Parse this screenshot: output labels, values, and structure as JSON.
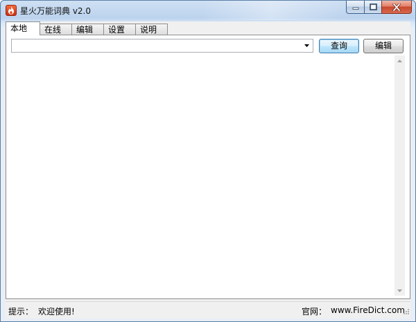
{
  "window": {
    "title": "星火万能词典 v2.0"
  },
  "tabs": [
    {
      "label": "本地",
      "active": true
    },
    {
      "label": "在线",
      "active": false
    },
    {
      "label": "编辑",
      "active": false
    },
    {
      "label": "设置",
      "active": false
    },
    {
      "label": "说明",
      "active": false
    }
  ],
  "search": {
    "value": ""
  },
  "buttons": {
    "query": "查询",
    "edit": "编辑"
  },
  "status": {
    "hint_label": "提示：",
    "hint_text": "欢迎使用!",
    "site_label": "官网：",
    "site_text": "www.FireDict.com"
  },
  "colors": {
    "accent": "#3c7fb1",
    "close_button": "#c8472c",
    "app_icon": "#e04a22"
  },
  "icons": {
    "app": "flame-icon",
    "minimize": "minimize-icon",
    "maximize": "maximize-icon",
    "close": "close-icon",
    "combo": "chevron-down-icon",
    "scroll_up": "scroll-up-arrow-icon",
    "scroll_down": "scroll-down-arrow-icon",
    "grip": "resize-grip-icon"
  }
}
